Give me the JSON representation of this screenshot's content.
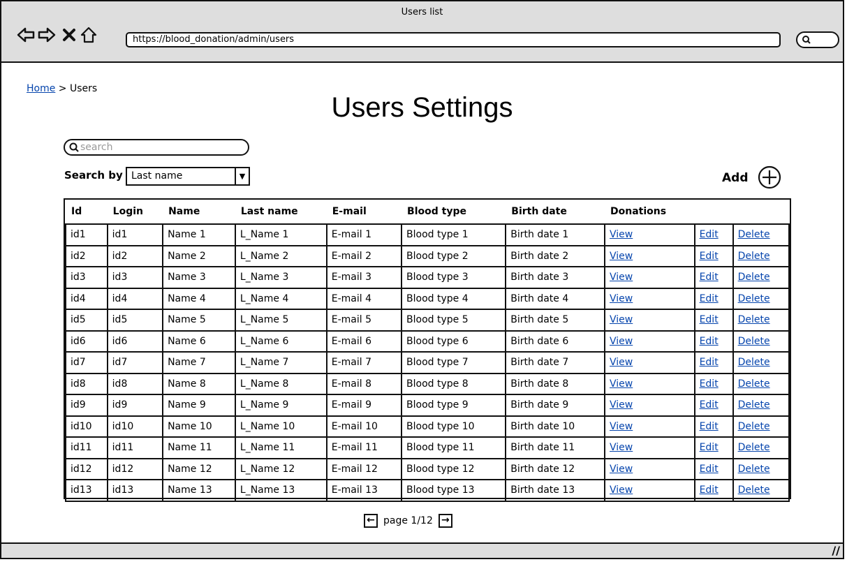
{
  "window": {
    "title": "Users list"
  },
  "browser": {
    "url": "https://blood_donation/admin/users"
  },
  "breadcrumb": {
    "home": "Home",
    "separator": ">",
    "current": "Users"
  },
  "page": {
    "title": "Users Settings"
  },
  "search": {
    "placeholder": "search",
    "search_by_label": "Search by",
    "search_by_value": "Last name"
  },
  "add": {
    "label": "Add"
  },
  "table": {
    "headers": [
      "Id",
      "Login",
      "Name",
      "Last name",
      "E-mail",
      "Blood type",
      "Birth date",
      "Donations",
      "",
      ""
    ],
    "action_labels": {
      "view": "View",
      "edit": "Edit",
      "delete": "Delete"
    },
    "rows": [
      [
        "id1",
        "id1",
        "Name 1",
        "L_Name 1",
        "E-mail 1",
        "Blood type 1",
        "Birth date 1"
      ],
      [
        "id2",
        "id2",
        "Name 2",
        "L_Name 2",
        "E-mail 2",
        "Blood type 2",
        "Birth date 2"
      ],
      [
        "id3",
        "id3",
        "Name 3",
        "L_Name 3",
        "E-mail 3",
        "Blood type 3",
        "Birth date 3"
      ],
      [
        "id4",
        "id4",
        "Name 4",
        "L_Name 4",
        "E-mail 4",
        "Blood type 4",
        "Birth date 4"
      ],
      [
        "id5",
        "id5",
        "Name 5",
        "L_Name 5",
        "E-mail 5",
        "Blood type 5",
        "Birth date 5"
      ],
      [
        "id6",
        "id6",
        "Name 6",
        "L_Name 6",
        "E-mail 6",
        "Blood type 6",
        "Birth date 6"
      ],
      [
        "id7",
        "id7",
        "Name 7",
        "L_Name 7",
        "E-mail 7",
        "Blood type 7",
        "Birth date 7"
      ],
      [
        "id8",
        "id8",
        "Name 8",
        "L_Name 8",
        "E-mail 8",
        "Blood type 8",
        "Birth date 8"
      ],
      [
        "id9",
        "id9",
        "Name 9",
        "L_Name 9",
        "E-mail 9",
        "Blood type 9",
        "Birth date 9"
      ],
      [
        "id10",
        "id10",
        "Name 10",
        "L_Name 10",
        "E-mail 10",
        "Blood type 10",
        "Birth date 10"
      ],
      [
        "id11",
        "id11",
        "Name 11",
        "L_Name 11",
        "E-mail 11",
        "Blood type 11",
        "Birth date 11"
      ],
      [
        "id12",
        "id12",
        "Name 12",
        "L_Name 12",
        "E-mail 12",
        "Blood type 12",
        "Birth date 12"
      ],
      [
        "id13",
        "id13",
        "Name 13",
        "L_Name 13",
        "E-mail 13",
        "Blood type 13",
        "Birth date 13"
      ]
    ]
  },
  "pagination": {
    "label": "page 1/12",
    "prev_icon": "arrow-left-icon",
    "next_icon": "arrow-right-icon"
  },
  "colors": {
    "chrome": "#dedede",
    "link": "#0645ad",
    "border": "#111111"
  }
}
